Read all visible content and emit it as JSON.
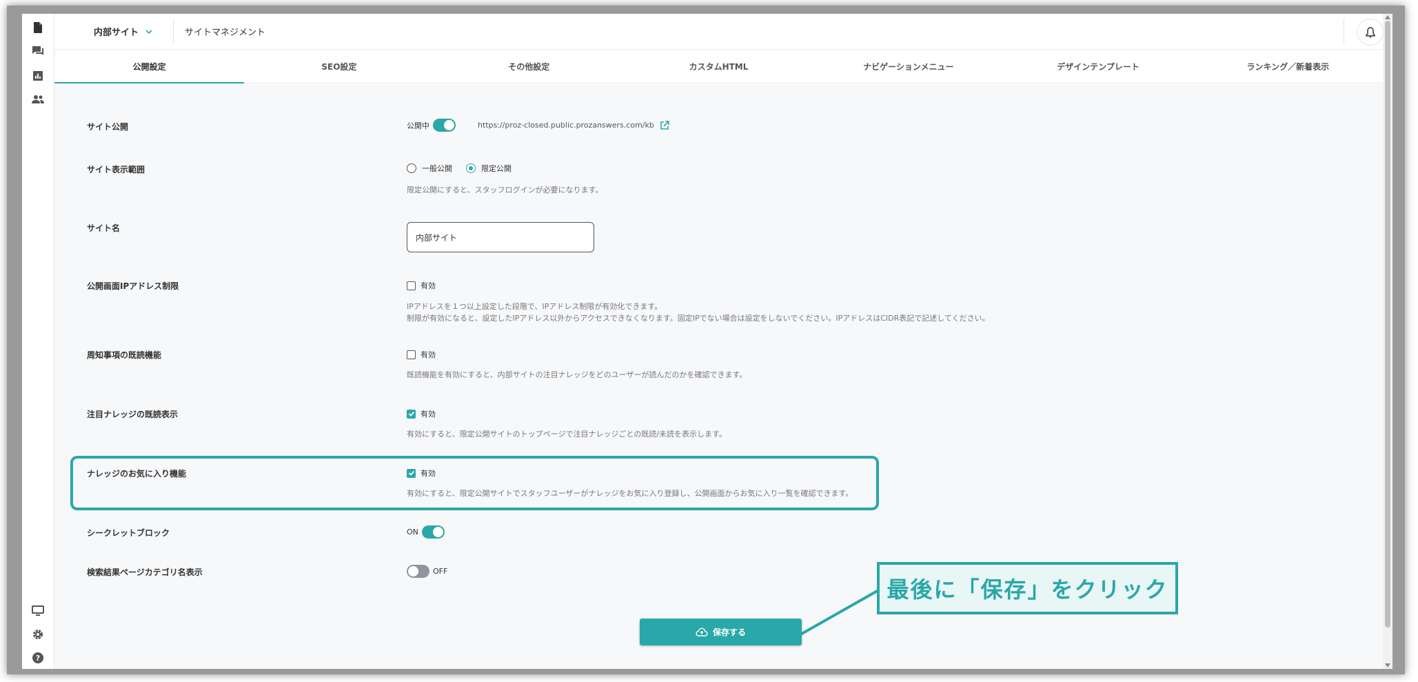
{
  "header": {
    "site_select": "内部サイト",
    "title": "サイトマネジメント"
  },
  "tabs": [
    {
      "label": "公開設定",
      "active": true
    },
    {
      "label": "SEO設定"
    },
    {
      "label": "その他設定"
    },
    {
      "label": "カスタムHTML"
    },
    {
      "label": "ナビゲーションメニュー"
    },
    {
      "label": "デザインテンプレート"
    },
    {
      "label": "ランキング／新着表示"
    }
  ],
  "settings": {
    "publish": {
      "label": "サイト公開",
      "status": "公開中",
      "enabled": true,
      "url": "https://proz-closed.public.prozanswers.com/kb"
    },
    "scope": {
      "label": "サイト表示範囲",
      "option_public": "一般公開",
      "option_limited": "限定公開",
      "selected": "限定公開",
      "desc": "限定公開にすると、スタッフログインが必要になります。"
    },
    "site_name": {
      "label": "サイト名",
      "value": "内部サイト"
    },
    "ip_restrict": {
      "label": "公開画面IPアドレス制限",
      "checkbox": "有効",
      "checked": false,
      "desc1": "IPアドレスを１つ以上設定した段階で、IPアドレス制限が有効化できます。",
      "desc2": "制限が有効になると、設定したIPアドレス以外からアクセスできなくなります。固定IPでない場合は設定をしないでください。IPアドレスはCIDR表記で記述してください。"
    },
    "read_notice": {
      "label": "周知事項の既読機能",
      "checkbox": "有効",
      "checked": false,
      "desc": "既読機能を有効にすると、内部サイトの注目ナレッジをどのユーザーが読んだのかを確認できます。"
    },
    "featured_read": {
      "label": "注目ナレッジの既読表示",
      "checkbox": "有効",
      "checked": true,
      "desc": "有効にすると、限定公開サイトのトップページで注目ナレッジごとの既読/未読を表示します。"
    },
    "favorites": {
      "label": "ナレッジのお気に入り機能",
      "checkbox": "有効",
      "checked": true,
      "desc": "有効にすると、限定公開サイトでスタッフユーザーがナレッジをお気に入り登録し、公開画面からお気に入り一覧を確認できます。"
    },
    "secret_block": {
      "label": "シークレットブロック",
      "state": "ON"
    },
    "category_name": {
      "label": "検索結果ページカテゴリ名表示",
      "state": "OFF"
    }
  },
  "save_button": "保存する",
  "callout": "最後に「保存」をクリック",
  "colors": {
    "accent": "#2aa7a9",
    "background": "#f7f8fa"
  },
  "icons": {
    "nav": [
      "document-icon",
      "chat-icon",
      "chart-icon",
      "users-icon",
      "monitor-icon",
      "gear-icon",
      "help-icon"
    ],
    "bell": "bell-icon",
    "external_link": "external-link-icon",
    "save": "cloud-upload-icon"
  }
}
